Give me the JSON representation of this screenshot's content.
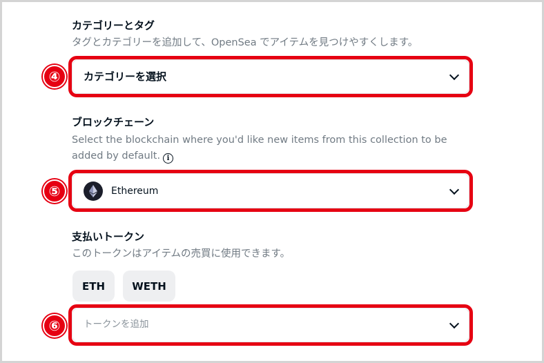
{
  "category": {
    "title": "カテゴリーとタグ",
    "description": "タグとカテゴリーを追加して、OpenSea でアイテムを見つけやすくします。",
    "select_label": "カテゴリーを選択",
    "annotation": "④"
  },
  "blockchain": {
    "title": "ブロックチェーン",
    "description": "Select the blockchain where you'd like new items from this collection to be added by default.",
    "selected": "Ethereum",
    "icon": "ethereum-icon",
    "annotation": "⑤"
  },
  "payment": {
    "title": "支払いトークン",
    "description": "このトークンはアイテムの売買に使用できます。",
    "tokens": [
      "ETH",
      "WETH"
    ],
    "add_placeholder": "トークンを追加",
    "annotation": "⑥"
  },
  "colors": {
    "annotation_red": "#e60012",
    "text_primary": "#04111d",
    "text_secondary": "#707a83",
    "token_bg": "#eeeff1"
  }
}
